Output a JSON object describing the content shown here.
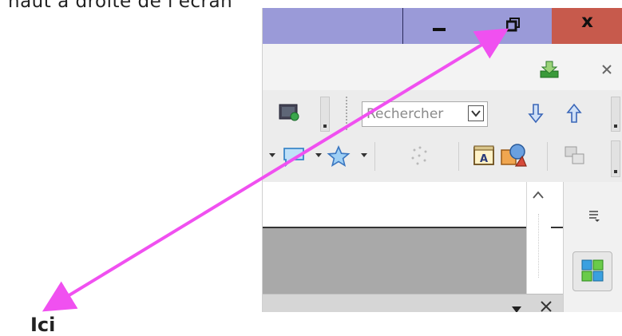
{
  "caption": {
    "top": "haut à droite de l'écran",
    "bottom": "Ici"
  },
  "window": {
    "close_label": "x"
  },
  "toolbar": {
    "search_placeholder": "Rechercher"
  },
  "colors": {
    "titlebar": "#9a9ad8",
    "close_button": "#c75a4c",
    "arrow": "#f050f0"
  },
  "icons": {
    "minimize": "minimize-icon",
    "restore": "restore-icon",
    "close": "close-icon",
    "download": "download-icon",
    "tab_close": "x-icon",
    "arrow_down": "arrow-down-icon",
    "arrow_up": "arrow-up-icon",
    "comment": "speech-bubble-icon",
    "star": "star-icon",
    "sidebar_menu": "hamburger-icon",
    "cubes": "cubes-icon"
  }
}
